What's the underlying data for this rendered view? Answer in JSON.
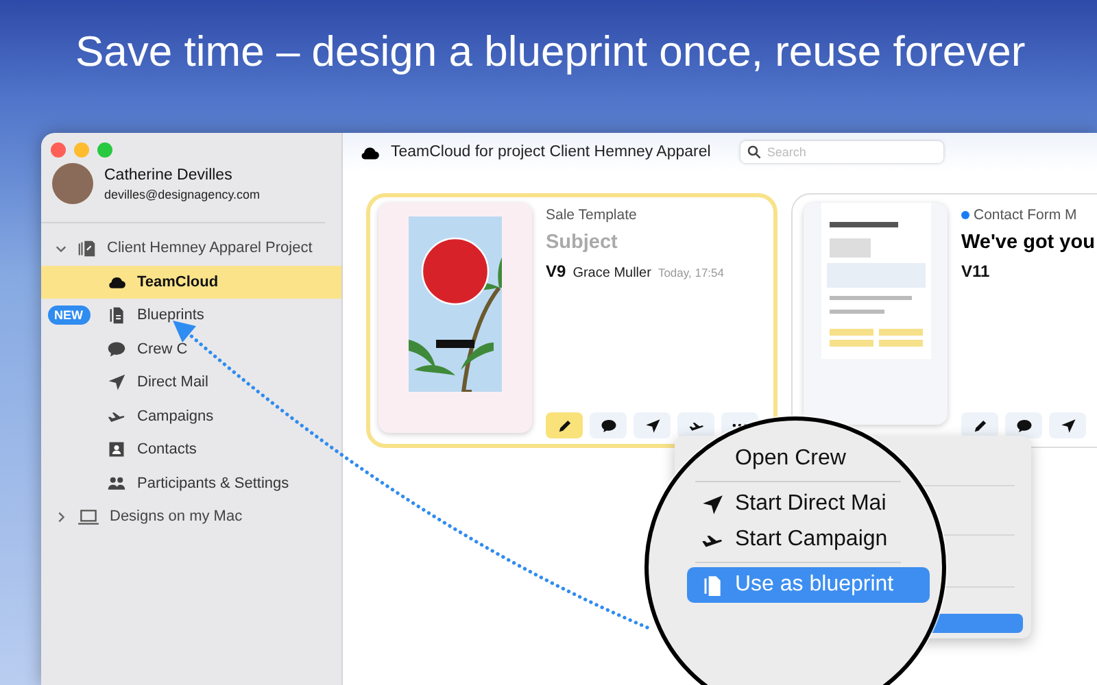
{
  "headline": "Save time – design a blueprint once, reuse forever",
  "user": {
    "name": "Catherine Devilles",
    "email": "devilles@designagency.com"
  },
  "sidebar": {
    "groups": [
      {
        "label": "Client Hemney Apparel Project",
        "kind": "project",
        "expanded": true,
        "children": [
          {
            "label": "TeamCloud",
            "kind": "cloud",
            "selected": true
          },
          {
            "label": "Blueprints",
            "kind": "blueprint",
            "selected": false,
            "badge": "NEW"
          },
          {
            "label": "Crew C",
            "kind": "chat",
            "selected": false
          },
          {
            "label": "Direct Mail",
            "kind": "send",
            "selected": false
          },
          {
            "label": "Campaigns",
            "kind": "jet",
            "selected": false
          },
          {
            "label": "Contacts",
            "kind": "contact",
            "selected": false
          },
          {
            "label": "Participants & Settings",
            "kind": "people",
            "selected": false
          }
        ]
      },
      {
        "label": "Designs on my Mac",
        "kind": "laptop",
        "expanded": false
      }
    ]
  },
  "toolbar": {
    "title": "TeamCloud for project Client Hemney Apparel",
    "search": {
      "placeholder": "Search"
    }
  },
  "cards": [
    {
      "kind": "poster",
      "name": "Sale Template",
      "unread": false,
      "subject": {
        "placeholder": "Subject"
      },
      "version": "V9",
      "author": "Grace Muller",
      "time": "Today, 17:54",
      "selected": true,
      "actions": [
        {
          "kind": "edit",
          "selected": true
        },
        {
          "kind": "chat",
          "selected": false
        },
        {
          "kind": "send",
          "selected": false
        },
        {
          "kind": "jet",
          "selected": false
        },
        {
          "kind": "more",
          "selected": false
        }
      ]
    },
    {
      "kind": "email",
      "name": "Contact Form M",
      "unread": true,
      "subject": {
        "value": "We've got you"
      },
      "version": "V11",
      "selected": false,
      "actions": [
        {
          "kind": "edit",
          "selected": false
        },
        {
          "kind": "chat",
          "selected": false
        },
        {
          "kind": "send",
          "selected": false
        }
      ]
    }
  ],
  "menu": {
    "items": [
      {
        "label": "Open Crew",
        "kind": "plain",
        "selected": false
      },
      {
        "label": "Start Direct Mai",
        "kind": "send",
        "selected": false
      },
      {
        "label": "Start Campaign",
        "kind": "jet",
        "selected": false
      },
      {
        "label": "Use as blueprint",
        "kind": "blueprint",
        "selected": true
      }
    ]
  }
}
